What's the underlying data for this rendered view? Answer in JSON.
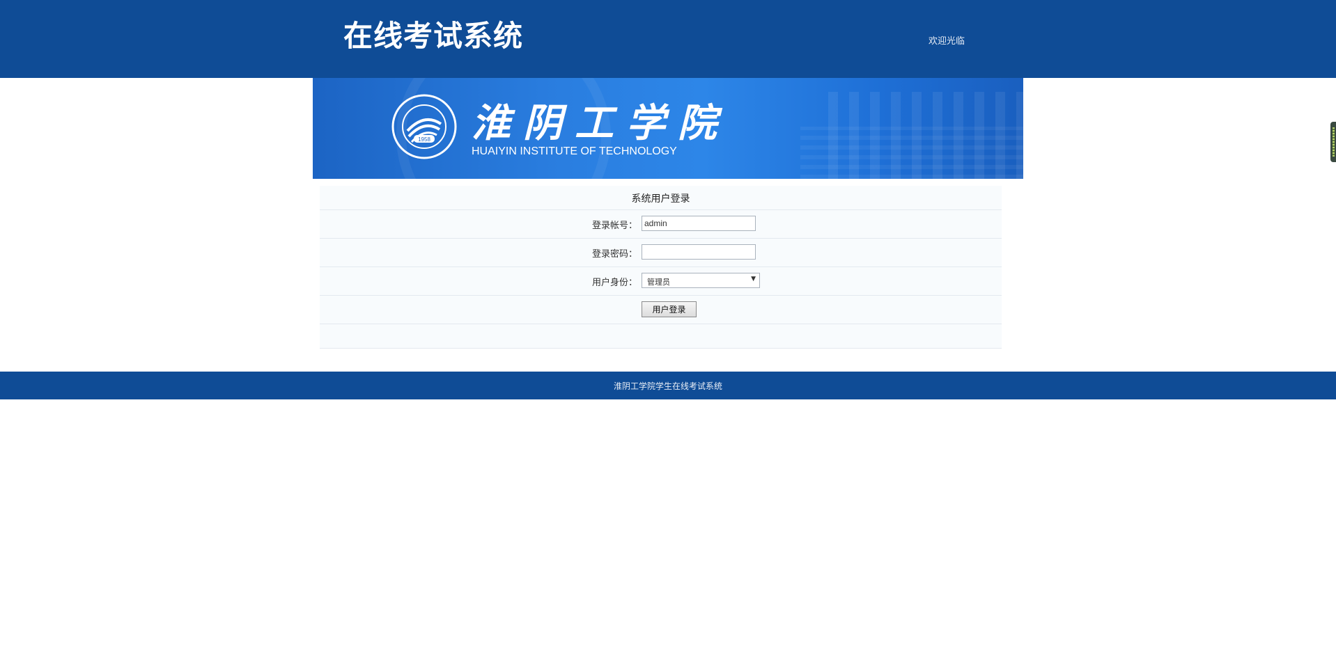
{
  "header": {
    "title": "在线考试系统",
    "welcome": "欢迎光临"
  },
  "banner": {
    "school_name_cn": "淮阴工学院",
    "school_name_en": "HUAIYIN INSTITUTE OF TECHNOLOGY",
    "seal_year": "1958"
  },
  "login_form": {
    "title": "系统用户登录",
    "account_label": "登录帐号：",
    "account_value": "admin",
    "password_label": "登录密码：",
    "password_value": "",
    "role_label": "用户身份：",
    "role_selected": "管理员",
    "submit_label": "用户登录"
  },
  "footer": {
    "text": "淮阴工学院学生在线考试系统"
  },
  "colors": {
    "header_bg": "#0f4c96",
    "footer_bg": "#0f4c96",
    "banner_accent": "#2a7ee0",
    "form_row_bg": "#f8fbfd"
  }
}
